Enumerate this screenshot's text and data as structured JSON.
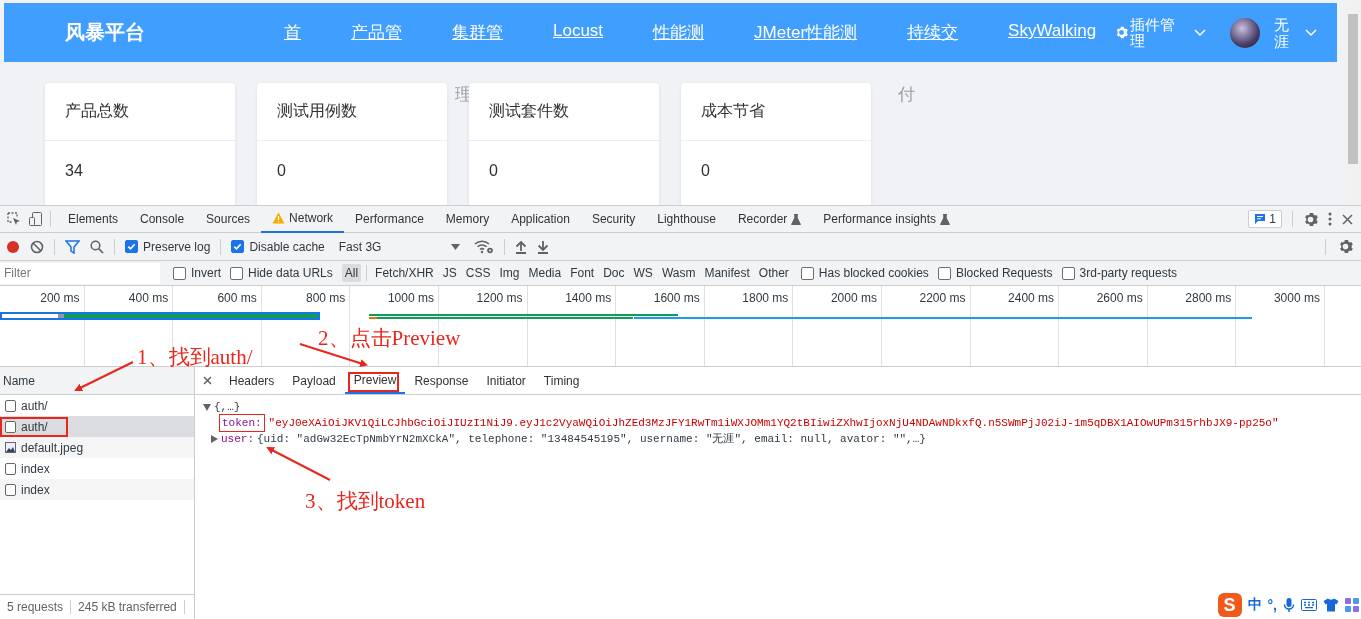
{
  "site": {
    "logo": "风暴平台",
    "nav": [
      {
        "label": "首"
      },
      {
        "label": "产品管"
      },
      {
        "label": "集群管"
      },
      {
        "label": "Locust"
      },
      {
        "label": "性能测"
      },
      {
        "label": "JMeter性能测"
      },
      {
        "label": "持续交"
      },
      {
        "label": "SkyWalking"
      }
    ],
    "nav_overflow": [
      "理",
      "付"
    ],
    "plugins": "插件管理",
    "user": "无涯",
    "cards": [
      {
        "title": "产品总数",
        "value": "34"
      },
      {
        "title": "测试用例数",
        "value": "0"
      },
      {
        "title": "测试套件数",
        "value": "0"
      },
      {
        "title": "成本节省",
        "value": "0"
      }
    ]
  },
  "devtools": {
    "tabs": [
      {
        "label": "Elements",
        "selected": false,
        "kind": "plain"
      },
      {
        "label": "Console",
        "selected": false,
        "kind": "plain"
      },
      {
        "label": "Sources",
        "selected": false,
        "kind": "plain"
      },
      {
        "label": "Network",
        "selected": true,
        "kind": "warning"
      },
      {
        "label": "Performance",
        "selected": false,
        "kind": "plain"
      },
      {
        "label": "Memory",
        "selected": false,
        "kind": "plain"
      },
      {
        "label": "Application",
        "selected": false,
        "kind": "plain"
      },
      {
        "label": "Security",
        "selected": false,
        "kind": "plain"
      },
      {
        "label": "Lighthouse",
        "selected": false,
        "kind": "plain"
      },
      {
        "label": "Recorder",
        "selected": false,
        "kind": "experimental"
      },
      {
        "label": "Performance insights",
        "selected": false,
        "kind": "experimental"
      }
    ],
    "issues": "1",
    "toolbar": {
      "preserve_log": {
        "label": "Preserve log",
        "checked": true
      },
      "disable_cache": {
        "label": "Disable cache",
        "checked": true
      },
      "throttling": "Fast 3G"
    },
    "filter": {
      "placeholder": "Filter",
      "invert": {
        "label": "Invert",
        "checked": false
      },
      "hide_data_urls": {
        "label": "Hide data URLs",
        "checked": false
      },
      "types": [
        {
          "label": "All",
          "selected": true
        },
        {
          "label": "Fetch/XHR",
          "selected": false
        },
        {
          "label": "JS",
          "selected": false
        },
        {
          "label": "CSS",
          "selected": false
        },
        {
          "label": "Img",
          "selected": false
        },
        {
          "label": "Media",
          "selected": false
        },
        {
          "label": "Font",
          "selected": false
        },
        {
          "label": "Doc",
          "selected": false
        },
        {
          "label": "WS",
          "selected": false
        },
        {
          "label": "Wasm",
          "selected": false
        },
        {
          "label": "Manifest",
          "selected": false
        },
        {
          "label": "Other",
          "selected": false
        }
      ],
      "options": [
        {
          "label": "Has blocked cookies",
          "checked": false
        },
        {
          "label": "Blocked Requests",
          "checked": false
        },
        {
          "label": "3rd-party requests",
          "checked": false
        }
      ]
    },
    "timeline_ticks": [
      "200 ms",
      "400 ms",
      "600 ms",
      "800 ms",
      "1000 ms",
      "1200 ms",
      "1400 ms",
      "1600 ms",
      "1800 ms",
      "2000 ms",
      "2200 ms",
      "2400 ms",
      "2600 ms",
      "2800 ms",
      "3000 ms"
    ],
    "requests": {
      "header": "Name",
      "rows": [
        {
          "name": "auth/",
          "kind": "document",
          "selected": false
        },
        {
          "name": "auth/",
          "kind": "document",
          "selected": true
        },
        {
          "name": "default.jpeg",
          "kind": "image",
          "selected": false
        },
        {
          "name": "index",
          "kind": "document",
          "selected": false
        },
        {
          "name": "index",
          "kind": "document",
          "selected": false
        }
      ]
    },
    "detail_tabs": [
      {
        "label": "Headers",
        "selected": false
      },
      {
        "label": "Payload",
        "selected": false
      },
      {
        "label": "Preview",
        "selected": true
      },
      {
        "label": "Response",
        "selected": false
      },
      {
        "label": "Initiator",
        "selected": false
      },
      {
        "label": "Timing",
        "selected": false
      }
    ],
    "preview": {
      "root": "{,…}",
      "token_key": "token:",
      "token_value": "\"eyJ0eXAiOiJKV1QiLCJhbGciOiJIUzI1NiJ9.eyJ1c2VyaWQiOiJhZEd3MzJFY1RwTm1iWXJOMm1YQ2tBIiwiZXhwIjoxNjU4NDAwNDkxfQ.n5SWmPjJ02iJ-1m5qDBX1AIOwUPm315rhbJX9-pp25o\"",
      "user_key": "user:",
      "user_value": "{uid: \"adGw32EcTpNmbYrN2mXCkA\", telephone: \"13484545195\", username: \"无涯\", email: null, avator: \"\",…}"
    },
    "status": [
      "5 requests",
      "245 kB transferred"
    ]
  },
  "annotations": [
    "1、找到auth/",
    "2、点击Preview",
    "3、找到token"
  ],
  "ime": {
    "logo": "S",
    "items": [
      "中",
      "°,"
    ]
  }
}
